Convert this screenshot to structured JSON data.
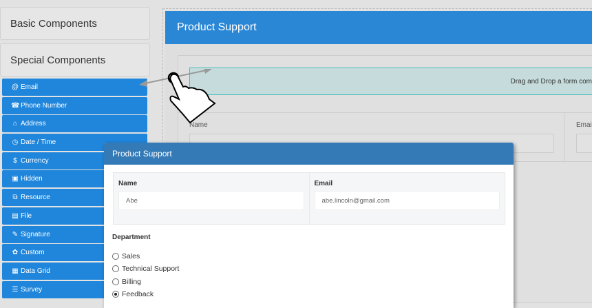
{
  "sidebar": {
    "basic_label": "Basic Components",
    "special_label": "Special Components",
    "items": [
      {
        "label": "Email",
        "icon": "@"
      },
      {
        "label": "Phone Number",
        "icon": "☎"
      },
      {
        "label": "Address",
        "icon": "⌂"
      },
      {
        "label": "Date / Time",
        "icon": "◷"
      },
      {
        "label": "Currency",
        "icon": "$"
      },
      {
        "label": "Hidden",
        "icon": "▣"
      },
      {
        "label": "Resource",
        "icon": "⧉"
      },
      {
        "label": "File",
        "icon": "▤"
      },
      {
        "label": "Signature",
        "icon": "✎"
      },
      {
        "label": "Custom",
        "icon": "✿"
      },
      {
        "label": "Data Grid",
        "icon": "▦"
      },
      {
        "label": "Survey",
        "icon": "☰"
      }
    ]
  },
  "builder": {
    "title": "Product Support",
    "drop_text": "Drag and Drop a form com",
    "name_label": "Name",
    "email_label": "Email"
  },
  "modal": {
    "title": "Product Support",
    "name_label": "Name",
    "name_value": "Abe",
    "email_label": "Email",
    "email_value": "abe.lincoln@gmail.com",
    "department_label": "Department",
    "options": [
      {
        "label": "Sales",
        "checked": false
      },
      {
        "label": "Technical Support",
        "checked": false
      },
      {
        "label": "Billing",
        "checked": false
      },
      {
        "label": "Feedback",
        "checked": true
      }
    ]
  }
}
